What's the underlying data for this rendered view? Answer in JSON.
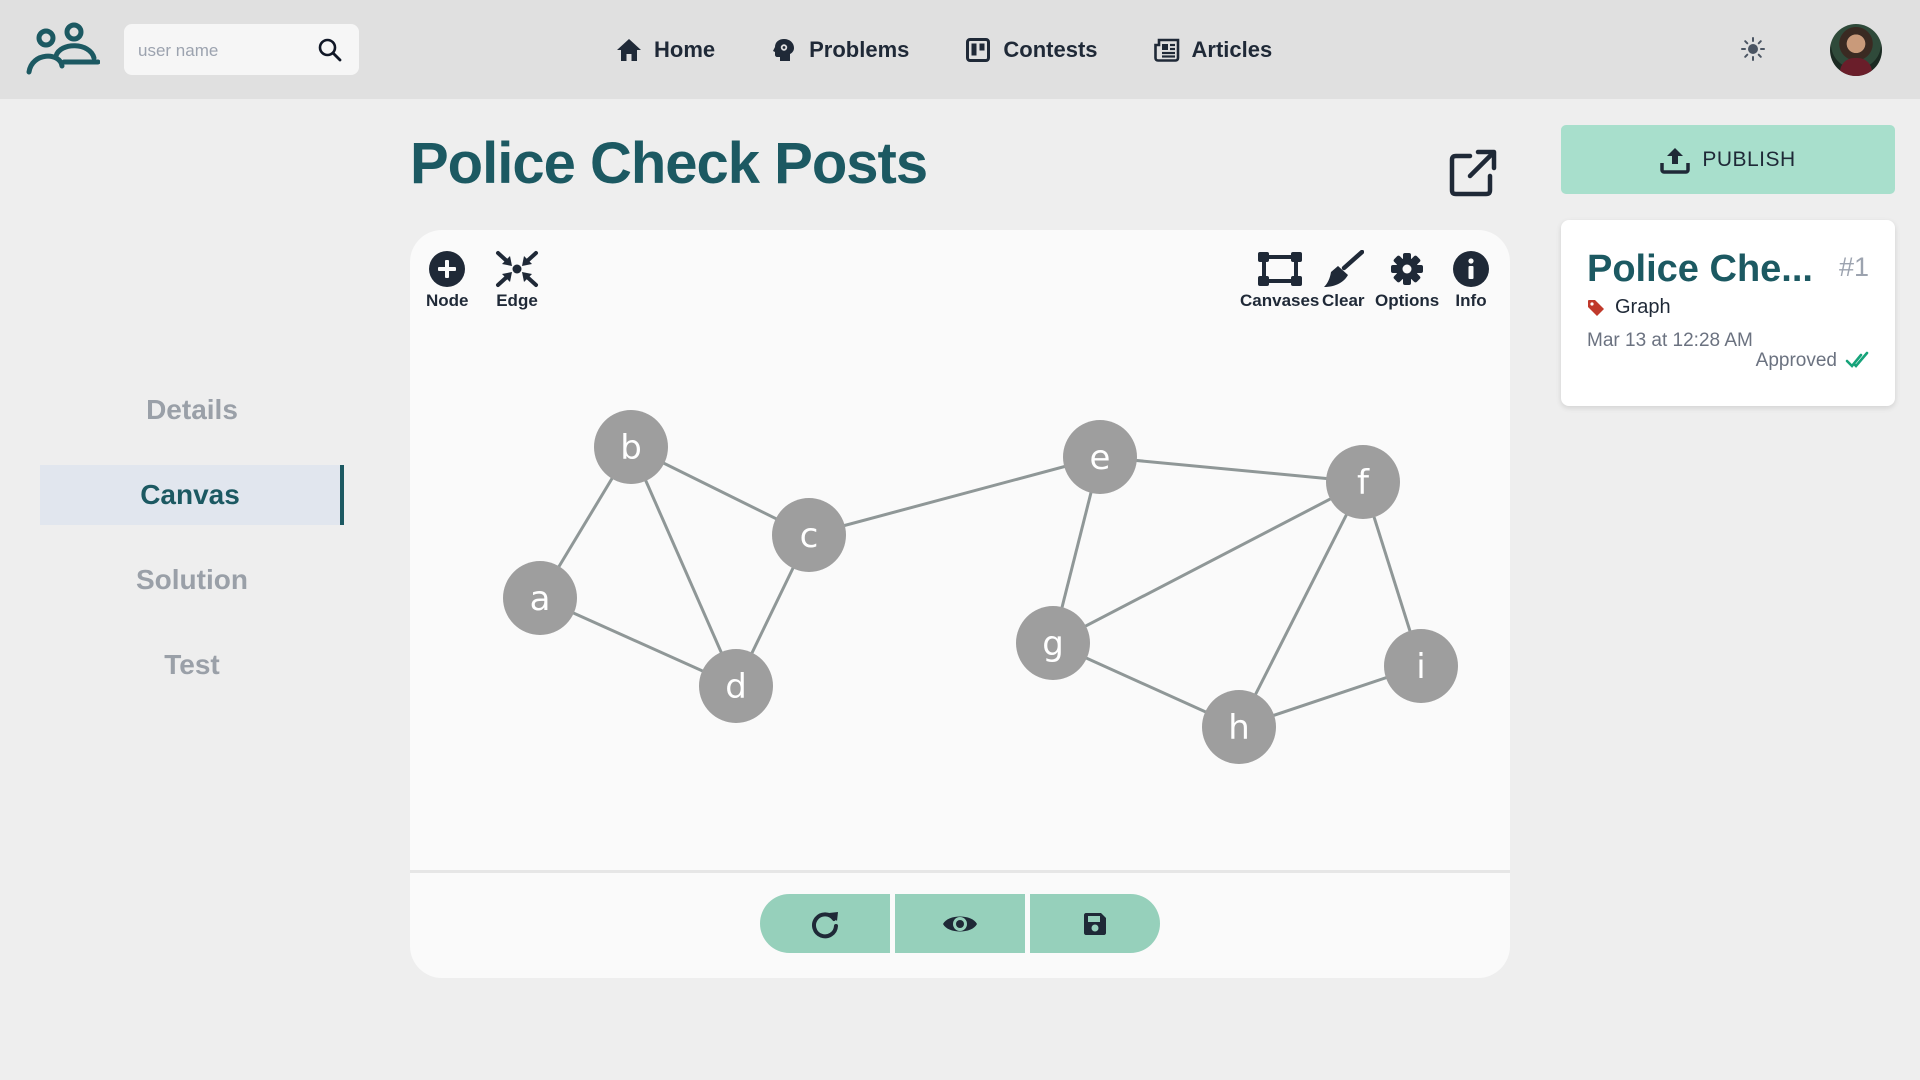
{
  "colors": {
    "brand": "#1c5962",
    "accent": "#96d0bb",
    "publish": "#a8dfcc",
    "node_fill": "#9e9e9e",
    "edge": "#8f9797",
    "tag": "#c0392b",
    "approved": "#16a37a"
  },
  "header": {
    "logo_icon": "people-logo-icon",
    "search": {
      "placeholder": "user name",
      "value": "",
      "icon": "search-icon"
    },
    "nav": [
      {
        "label": "Home",
        "icon": "home-icon"
      },
      {
        "label": "Problems",
        "icon": "brain-icon"
      },
      {
        "label": "Contests",
        "icon": "board-icon"
      },
      {
        "label": "Articles",
        "icon": "newspaper-icon"
      }
    ],
    "theme_icon": "sun-icon",
    "avatar_icon": "user-avatar"
  },
  "sidebar": {
    "items": [
      {
        "label": "Details",
        "active": false
      },
      {
        "label": "Canvas",
        "active": true
      },
      {
        "label": "Solution",
        "active": false
      },
      {
        "label": "Test",
        "active": false
      }
    ]
  },
  "main": {
    "title": "Police Check Posts",
    "open_external_icon": "external-link-icon",
    "toolbar_left": [
      {
        "label": "Node",
        "icon": "plus-circle-icon"
      },
      {
        "label": "Edge",
        "icon": "compress-icon"
      }
    ],
    "toolbar_right": [
      {
        "label": "Canvases",
        "icon": "vector-square-icon"
      },
      {
        "label": "Clear",
        "icon": "broom-icon"
      },
      {
        "label": "Options",
        "icon": "gear-icon"
      },
      {
        "label": "Info",
        "icon": "info-icon"
      }
    ],
    "graph": {
      "nodes": [
        "a",
        "b",
        "c",
        "d",
        "e",
        "f",
        "g",
        "h",
        "i"
      ],
      "edges": [
        [
          "a",
          "b"
        ],
        [
          "a",
          "d"
        ],
        [
          "b",
          "c"
        ],
        [
          "b",
          "d"
        ],
        [
          "c",
          "d"
        ],
        [
          "c",
          "e"
        ],
        [
          "e",
          "f"
        ],
        [
          "e",
          "g"
        ],
        [
          "f",
          "g"
        ],
        [
          "f",
          "h"
        ],
        [
          "f",
          "i"
        ],
        [
          "g",
          "h"
        ],
        [
          "h",
          "i"
        ]
      ]
    },
    "actions": [
      {
        "name": "reset",
        "icon": "redo-icon"
      },
      {
        "name": "preview",
        "icon": "eye-icon"
      },
      {
        "name": "save",
        "icon": "save-icon"
      }
    ]
  },
  "panel": {
    "publish_label": "PUBLISH",
    "publish_icon": "upload-icon",
    "card": {
      "title": "Police Che...",
      "number": "#1",
      "tag": "Graph",
      "tag_icon": "tag-icon",
      "date": "Mar 13 at 12:28 AM",
      "status": "Approved",
      "status_icon": "check-double-icon"
    }
  }
}
